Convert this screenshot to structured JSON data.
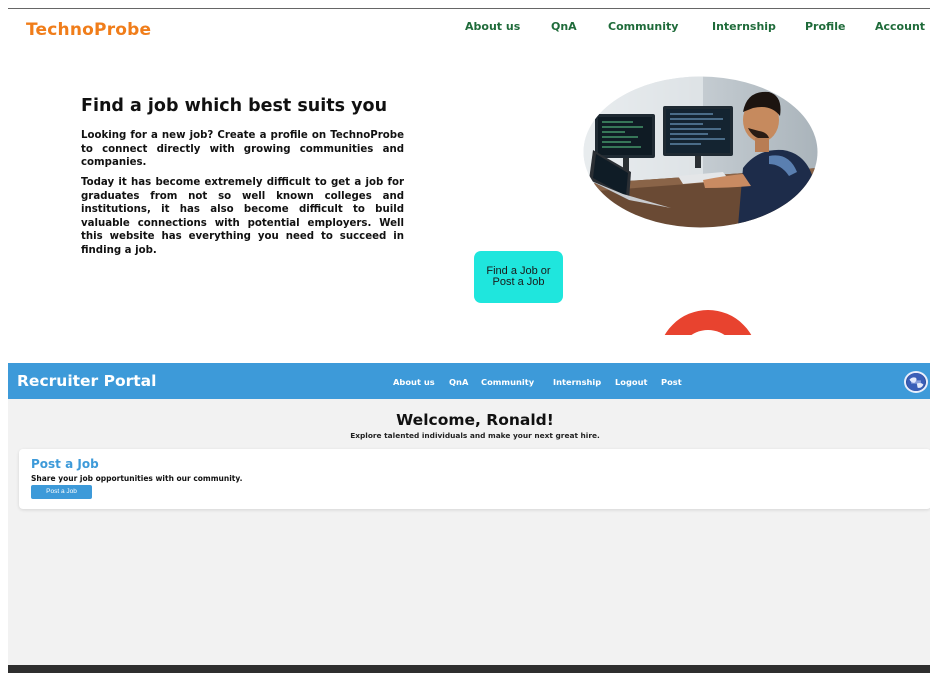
{
  "technoprobe": {
    "brand": "TechnoProbe",
    "nav": [
      "About us",
      "QnA",
      "Community",
      "Internship",
      "Profile",
      "Account"
    ],
    "hero": {
      "title": "Find a job which best suits you",
      "paragraph1": "Looking for a new job? Create a profile on TechnoProbe to connect directly with growing communities and companies.",
      "paragraph2": "Today it has become extremely difficult to get a job for graduates from not so well known colleges and institutions, it has also become difficult to build valuable connections with potential employers. Well this website has everything you need to succeed in finding a job.",
      "cta": "Find a Job or Post a Job"
    },
    "colors": {
      "brand": "#f07d1a",
      "nav": "#1f6b3a",
      "cta": "#1fe6dd"
    }
  },
  "portal": {
    "title": "Recruiter Portal",
    "nav": [
      "About us",
      "QnA",
      "Community",
      "Internship",
      "Logout",
      "Post"
    ],
    "welcome": "Welcome, Ronald!",
    "welcome_sub": "Explore talented individuals and make your next great hire.",
    "card": {
      "title": "Post a Job",
      "description": "Share your job opportunities with our community.",
      "button": "Post a Job"
    },
    "colors": {
      "header": "#3d9ad9",
      "background": "#f2f2f2",
      "footer": "#2e2e2e"
    },
    "icons": {
      "profile": "globe-avatar-icon"
    }
  }
}
